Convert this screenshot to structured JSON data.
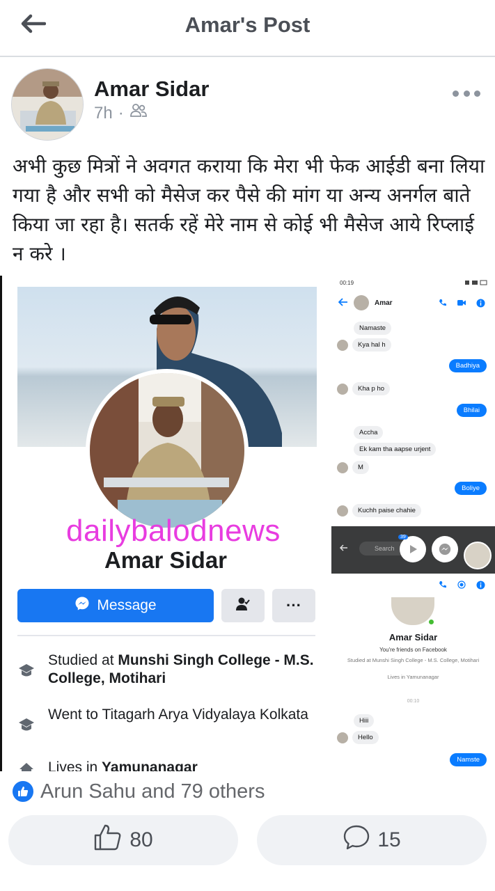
{
  "header": {
    "title": "Amar's Post"
  },
  "post": {
    "author": "Amar Sidar",
    "time": "7h",
    "separator": "·",
    "text": "अभी कुछ मित्रों ने अवगत कराया कि मेरा भी फेक आईडी बना लिया गया है और सभी को मैसेज कर पैसे की मांग या अन्य अनर्गल बाते किया जा रहा है। सतर्क रहें मेरे नाम से कोई भी मैसेज आये रिप्लाई न करे ।"
  },
  "image": {
    "watermark": "dailybalodnews",
    "profile": {
      "name": "Amar Sidar",
      "message_label": "Message",
      "more_label": "···",
      "info": [
        {
          "prefix": "Studied at ",
          "bold": "Munshi Singh College - M.S. College, Motihari"
        },
        {
          "prefix": "Went to Titagarh Arya Vidyalaya Kolkata",
          "bold": ""
        },
        {
          "prefix": "Lives in ",
          "bold": "Yamunanagar"
        }
      ]
    },
    "chat": {
      "status_left": "00:19",
      "contact": "Amar",
      "messages": [
        {
          "dir": "in",
          "text": "Namaste"
        },
        {
          "dir": "in",
          "text": "Kya hal h"
        },
        {
          "dir": "out",
          "text": "Badhiya"
        },
        {
          "dir": "in",
          "text": "Kha p ho"
        },
        {
          "dir": "out",
          "text": "Bhilai"
        },
        {
          "dir": "in",
          "text": "Accha"
        },
        {
          "dir": "in",
          "text": "Ek kam tha aapse urjent"
        },
        {
          "dir": "in",
          "text": "M"
        },
        {
          "dir": "out",
          "text": "Boliye"
        },
        {
          "dir": "in",
          "text": "Kuchh paise chahie"
        }
      ],
      "search_placeholder": "Search",
      "card_name": "Amar Sidar",
      "card_friends": "You're friends on Facebook",
      "card_studied": "Studied at Munshi Singh College - M.S. College, Motihari",
      "card_lives": "Lives in Yamunanagar",
      "card_time": "00:10",
      "late_messages": [
        {
          "dir": "in",
          "text": "Hiii"
        },
        {
          "dir": "in",
          "text": "Hello"
        },
        {
          "dir": "out",
          "text": "Namste"
        }
      ],
      "badge_count": "39"
    }
  },
  "reactions": {
    "text": "Arun Sahu and 79 others"
  },
  "actions": {
    "like_count": "80",
    "comment_count": "15"
  },
  "colors": {
    "brand_blue": "#1877f2",
    "watermark": "#e83ce0",
    "messenger_blue": "#0a7cff"
  }
}
